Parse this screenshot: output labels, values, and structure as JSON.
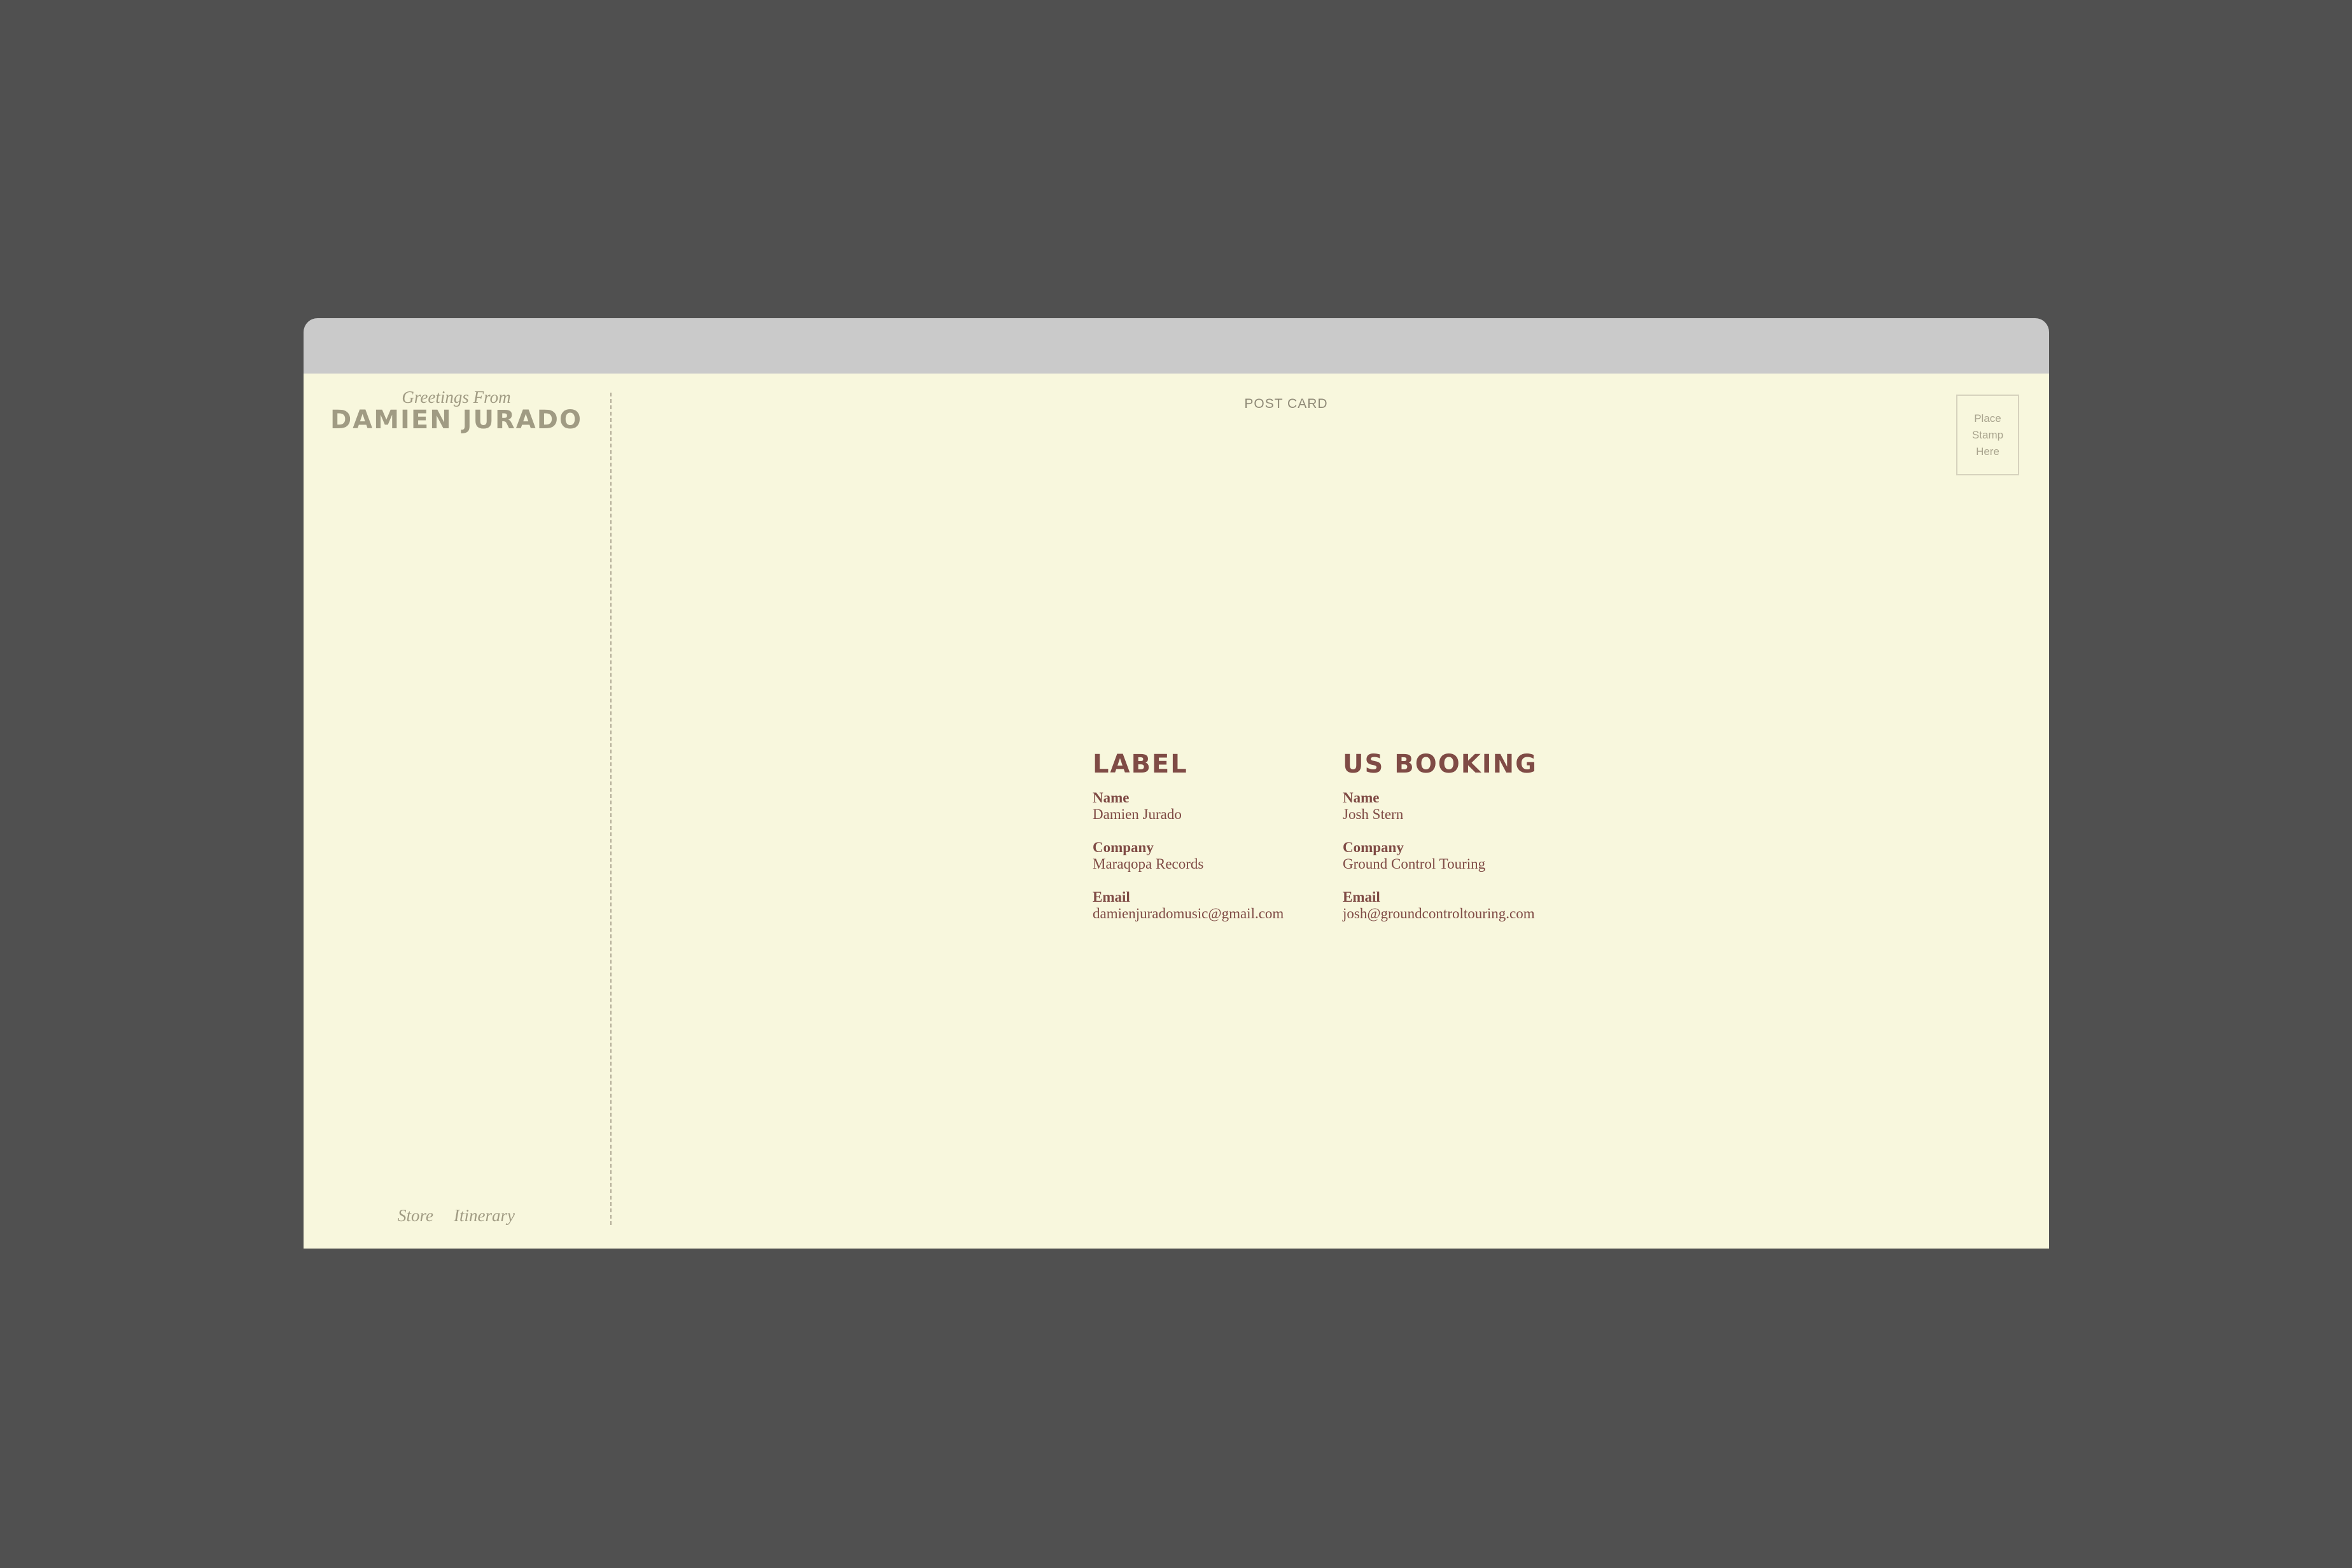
{
  "card": {
    "greeting": "Greetings From",
    "artist": "DAMIEN JURADO",
    "header_label": "POST CARD",
    "stamp_text": "Place\nStamp\nHere"
  },
  "nav": {
    "items": [
      {
        "label": "Store"
      },
      {
        "label": "Itinerary"
      }
    ]
  },
  "contacts": [
    {
      "title": "LABEL",
      "fields": [
        {
          "label": "Name",
          "value": "Damien Jurado"
        },
        {
          "label": "Company",
          "value": "Maraqopa Records"
        },
        {
          "label": "Email",
          "value": "damienjuradomusic@gmail.com"
        }
      ]
    },
    {
      "title": "US BOOKING",
      "fields": [
        {
          "label": "Name",
          "value": "Josh Stern"
        },
        {
          "label": "Company",
          "value": "Ground Control Touring"
        },
        {
          "label": "Email",
          "value": "josh@groundcontroltouring.com"
        }
      ]
    }
  ]
}
